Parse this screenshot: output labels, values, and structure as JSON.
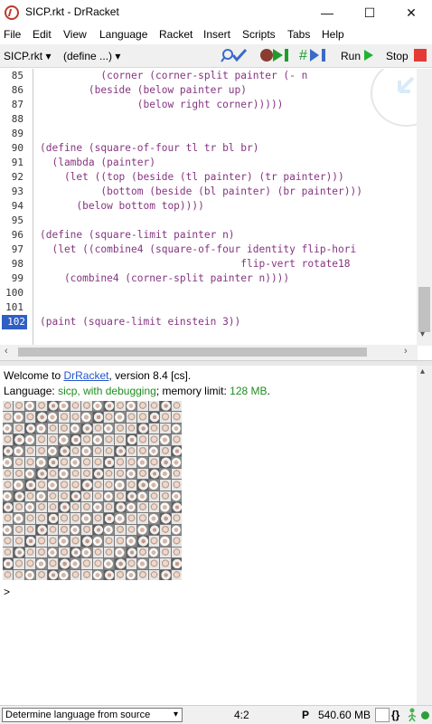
{
  "window": {
    "title": "SICP.rkt - DrRacket",
    "controls": [
      "—",
      "☐",
      "✕"
    ]
  },
  "menu": [
    "File",
    "Edit",
    "View",
    "Language",
    "Racket",
    "Insert",
    "Scripts",
    "Tabs",
    "Help"
  ],
  "toolbar": {
    "file": "SICP.rkt",
    "file_arrow": "▾",
    "define": "(define ...)",
    "define_arrow": "▾",
    "run": "Run",
    "stop": "Stop"
  },
  "editor": {
    "lines": [
      {
        "n": "85",
        "code": "          (corner (corner-split painter (- n"
      },
      {
        "n": "86",
        "code": "        (beside (below painter up)"
      },
      {
        "n": "87",
        "code": "                (below right corner)))))"
      },
      {
        "n": "88",
        "code": ""
      },
      {
        "n": "89",
        "code": ""
      },
      {
        "n": "90",
        "code": "(define (square-of-four tl tr bl br)"
      },
      {
        "n": "91",
        "code": "  (lambda (painter)"
      },
      {
        "n": "92",
        "code": "    (let ((top (beside (tl painter) (tr painter)))"
      },
      {
        "n": "93",
        "code": "          (bottom (beside (bl painter) (br painter)))"
      },
      {
        "n": "94",
        "code": "      (below bottom top))))"
      },
      {
        "n": "95",
        "code": ""
      },
      {
        "n": "96",
        "code": "(define (square-limit painter n)"
      },
      {
        "n": "97",
        "code": "  (let ((combine4 (square-of-four identity flip-hori"
      },
      {
        "n": "98",
        "code": "                                 flip-vert rotate18"
      },
      {
        "n": "99",
        "code": "    (combine4 (corner-split painter n))))"
      },
      {
        "n": "100",
        "code": ""
      },
      {
        "n": "101",
        "code": ""
      },
      {
        "n": "102",
        "code": "(paint (square-limit einstein 3))"
      }
    ]
  },
  "repl": {
    "welcome_prefix": "Welcome to ",
    "welcome_link": "DrRacket",
    "welcome_suffix": ", version 8.4 [cs].",
    "language_prefix": "Language: ",
    "language_name": "sicp, with debugging",
    "language_suffix": "; memory limit: ",
    "memory_limit": "128 MB",
    "period": ".",
    "prompt": ">"
  },
  "status": {
    "language_select": "Determine language from source",
    "position": "4:2",
    "mode": "P",
    "memory": "540.60 MB",
    "brackets": "{}"
  },
  "colors": {
    "code": "#853580",
    "link": "#2255cc",
    "language": "#228b22",
    "selection": "#2f5fc4"
  }
}
